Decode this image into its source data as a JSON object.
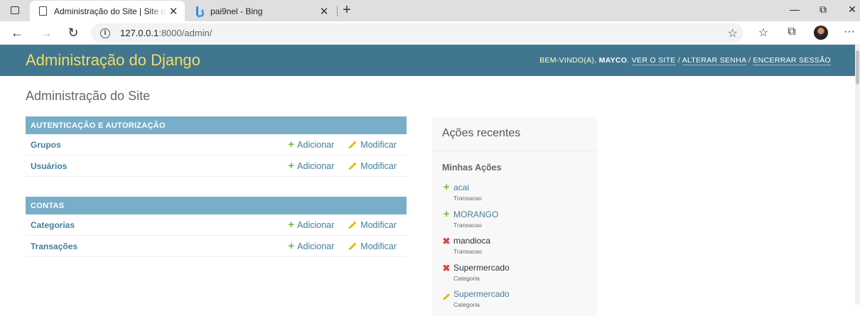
{
  "browser": {
    "tabs": [
      {
        "title": "Administração do Site | Site de a",
        "icon": "document-icon",
        "active": true
      },
      {
        "title": "pai9nel - Bing",
        "icon": "bing-icon",
        "active": false
      }
    ],
    "url_host": "127.0.0.1",
    "url_rest": ":8000/admin/"
  },
  "header": {
    "branding": "Administração do Django",
    "welcome": "Bem-vindo(a),",
    "username": "Mayco",
    "links": {
      "view_site": "Ver o site",
      "change_password": "Alterar senha",
      "logout": "Encerrar sessão"
    },
    "separator": " / "
  },
  "page_title": "Administração do Site",
  "modules": [
    {
      "caption": "Autenticação e Autorização",
      "models": [
        {
          "name": "Grupos",
          "add": "Adicionar",
          "change": "Modificar"
        },
        {
          "name": "Usuários",
          "add": "Adicionar",
          "change": "Modificar"
        }
      ]
    },
    {
      "caption": "Contas",
      "models": [
        {
          "name": "Categorias",
          "add": "Adicionar",
          "change": "Modificar"
        },
        {
          "name": "Transações",
          "add": "Adicionar",
          "change": "Modificar"
        }
      ]
    }
  ],
  "recent_actions": {
    "title": "Ações recentes",
    "subtitle": "Minhas Ações",
    "items": [
      {
        "name": "acai",
        "type": "Transacao",
        "action": "add"
      },
      {
        "name": "MORANGO",
        "type": "Transacao",
        "action": "add"
      },
      {
        "name": "mandioca",
        "type": "Transacao",
        "action": "delete"
      },
      {
        "name": "Supermercado",
        "type": "Categoria",
        "action": "delete"
      },
      {
        "name": "Supermercado",
        "type": "Categoria",
        "action": "change"
      }
    ]
  },
  "colors": {
    "header_bg": "#417690",
    "branding": "#f5dd5d",
    "module_caption": "#79aec8",
    "link": "#447e9b",
    "add_icon": "#70bf2b",
    "delete_icon": "#dd4646",
    "change_icon": "#efb80b"
  }
}
